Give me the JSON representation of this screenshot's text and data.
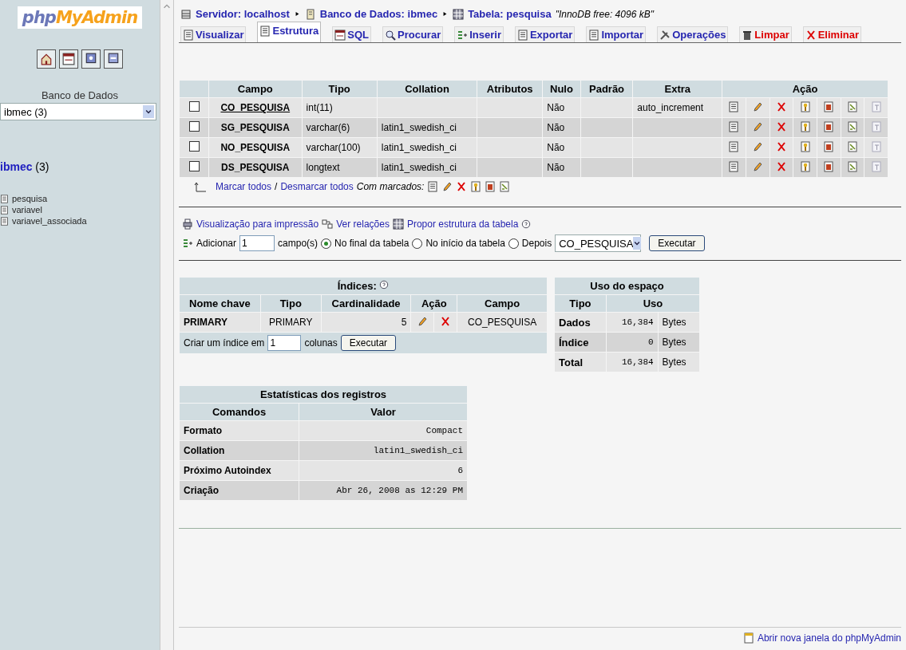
{
  "sidebar": {
    "logo": {
      "prefix": "php",
      "suffix": "MyAdmin"
    },
    "db_label": "Banco de Dados",
    "db_select": "ibmec (3)",
    "db_heading": {
      "name": "ibmec",
      "count": "(3)"
    },
    "tables": [
      "pesquisa",
      "variavel",
      "variavel_associada"
    ]
  },
  "breadcrumb": {
    "items": [
      {
        "kind": "server",
        "label": "Servidor: localhost"
      },
      {
        "kind": "database",
        "label": "Banco de Dados: ibmec"
      },
      {
        "kind": "table",
        "label": "Tabela: pesquisa"
      }
    ],
    "note": "\"InnoDB free: 4096 kB\""
  },
  "tabs": [
    {
      "label": "Visualizar",
      "kind": "normal",
      "selected": false
    },
    {
      "label": "Estrutura",
      "kind": "normal",
      "selected": true
    },
    {
      "label": "SQL",
      "kind": "normal",
      "selected": false
    },
    {
      "label": "Procurar",
      "kind": "normal",
      "selected": false
    },
    {
      "label": "Inserir",
      "kind": "normal",
      "selected": false
    },
    {
      "label": "Exportar",
      "kind": "normal",
      "selected": false
    },
    {
      "label": "Importar",
      "kind": "normal",
      "selected": false
    },
    {
      "label": "Operações",
      "kind": "normal",
      "selected": false
    },
    {
      "label": "Limpar",
      "kind": "danger",
      "selected": false
    },
    {
      "label": "Eliminar",
      "kind": "danger",
      "selected": false
    }
  ],
  "structure": {
    "columns": [
      "Campo",
      "Tipo",
      "Collation",
      "Atributos",
      "Nulo",
      "Padrão",
      "Extra",
      "Ação"
    ],
    "rows": [
      {
        "checked": false,
        "primary": true,
        "campo": "CO_PESQUISA",
        "tipo": "int(11)",
        "collation": "",
        "nulo": "Não",
        "extra": "auto_increment"
      },
      {
        "checked": false,
        "primary": false,
        "campo": "SG_PESQUISA",
        "tipo": "varchar(6)",
        "collation": "latin1_swedish_ci",
        "nulo": "Não",
        "extra": ""
      },
      {
        "checked": false,
        "primary": false,
        "campo": "NO_PESQUISA",
        "tipo": "varchar(100)",
        "collation": "latin1_swedish_ci",
        "nulo": "Não",
        "extra": ""
      },
      {
        "checked": false,
        "primary": false,
        "campo": "DS_PESQUISA",
        "tipo": "longtext",
        "collation": "latin1_swedish_ci",
        "nulo": "Não",
        "extra": ""
      }
    ],
    "check_all": "Marcar todos",
    "separator": "/",
    "uncheck_all": "Desmarcar todos",
    "with_selected": "Com marcados:"
  },
  "links": [
    {
      "kind": "print",
      "label": "Visualização para impressão"
    },
    {
      "kind": "relations",
      "label": "Ver relações"
    },
    {
      "kind": "propose",
      "label": "Propor estrutura da tabela"
    }
  ],
  "add_fields": {
    "label": "Adicionar",
    "value": "1",
    "unit": "campo(s)",
    "options": [
      {
        "label": "No final da tabela",
        "selected": true
      },
      {
        "label": "No início da tabela",
        "selected": false
      },
      {
        "label": "Depois",
        "selected": false
      }
    ],
    "after": "CO_PESQUISA",
    "button": "Executar"
  },
  "indexes": {
    "title": "Índices:",
    "columns": [
      "Nome chave",
      "Tipo",
      "Cardinalidade",
      "Ação",
      "Campo"
    ],
    "rows": [
      {
        "name": "PRIMARY",
        "type": "PRIMARY",
        "cardinality": "5",
        "field": "CO_PESQUISA"
      }
    ],
    "create": {
      "label": "Criar um índice em",
      "value": "1",
      "unit": "colunas",
      "button": "Executar"
    }
  },
  "space": {
    "title": "Uso do espaço",
    "columns": [
      "Tipo",
      "Uso"
    ],
    "rows": [
      {
        "type": "Dados",
        "value": "16,384",
        "unit": "Bytes"
      },
      {
        "type": "Índice",
        "value": "0",
        "unit": "Bytes"
      },
      {
        "type": "Total",
        "value": "16,384",
        "unit": "Bytes"
      }
    ]
  },
  "stats": {
    "title": "Estatísticas dos registros",
    "columns": [
      "Comandos",
      "Valor"
    ],
    "rows": [
      {
        "label": "Formato",
        "value": "Compact"
      },
      {
        "label": "Collation",
        "value": "latin1_swedish_ci"
      },
      {
        "label": "Próximo Autoindex",
        "value": "6"
      },
      {
        "label": "Criação",
        "value": "Abr 26, 2008 as 12:29 PM"
      }
    ]
  },
  "footer_link": "Abrir nova janela do phpMyAdmin"
}
